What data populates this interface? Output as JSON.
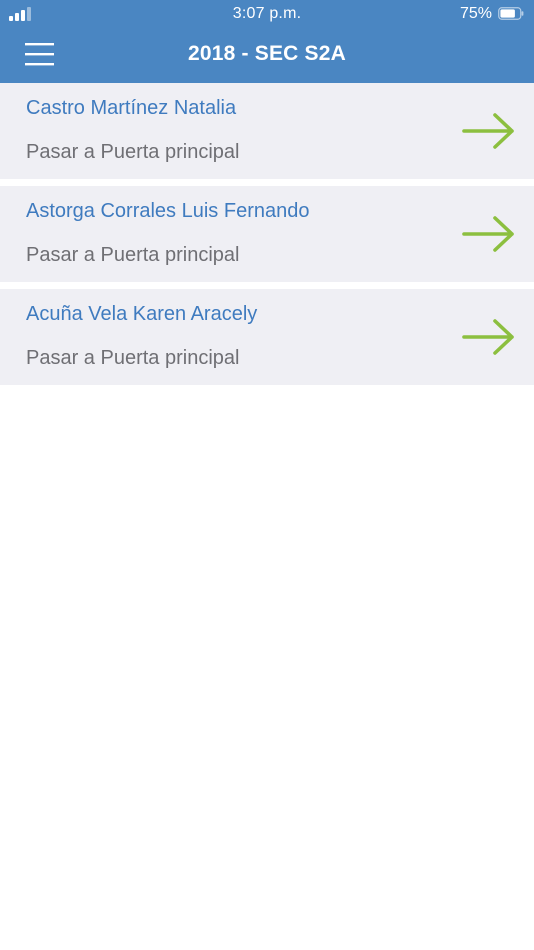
{
  "status_bar": {
    "time": "3:07 p.m.",
    "battery_percent": "75%",
    "battery_level": 0.75,
    "signal_bars_filled": 3,
    "signal_bars_total": 4
  },
  "header": {
    "title": "2018 - SEC S2A",
    "menu_icon": "hamburger-menu-icon"
  },
  "students": [
    {
      "name": "Castro Martínez Natalia",
      "status": "Pasar a Puerta principal"
    },
    {
      "name": "Astorga Corrales Luis Fernando",
      "status": "Pasar a Puerta principal"
    },
    {
      "name": "Acuña Vela Karen Aracely",
      "status": "Pasar a Puerta principal"
    }
  ],
  "icons": {
    "row_action": "arrow-right-icon"
  },
  "colors": {
    "header_bg": "#4a86c2",
    "row_bg": "#efeff4",
    "name_text": "#3f7bbf",
    "status_text": "#6f6f74",
    "arrow": "#8cbf3f"
  }
}
